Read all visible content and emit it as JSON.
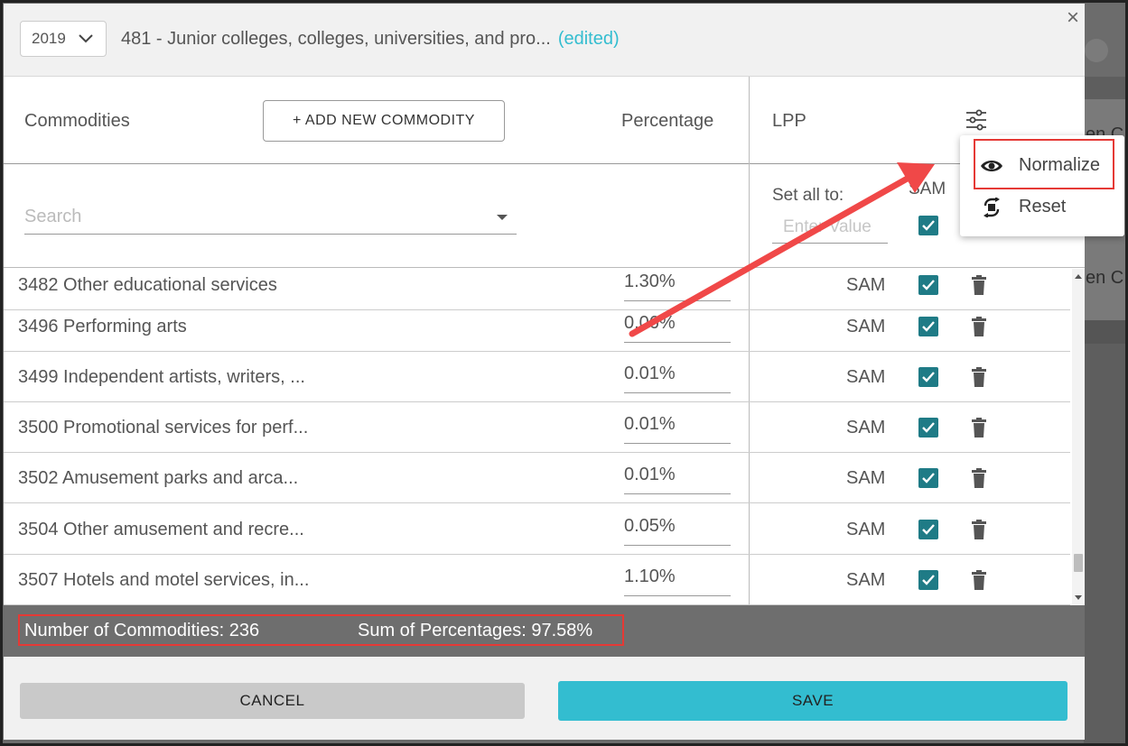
{
  "header": {
    "year": "2019",
    "sector_title": "481 - Junior colleges, colleges, universities, and pro...",
    "edited_label": "(edited)",
    "close_label": "×"
  },
  "columns": {
    "commodities": "Commodities",
    "add_button": "+ ADD NEW COMMODITY",
    "percentage": "Percentage",
    "lpp": "LPP"
  },
  "filters": {
    "search_placeholder": "Search",
    "set_all_label": "Set all to:",
    "set_all_placeholder": "Enter Value",
    "sam_label": "SAM"
  },
  "rows": [
    {
      "name": "3482 Other educational services",
      "percentage": "1.30%",
      "lpp": "SAM",
      "checked": true
    },
    {
      "name": "3496 Performing arts",
      "percentage": "0.06%",
      "lpp": "SAM",
      "checked": true
    },
    {
      "name": "3499 Independent artists, writers, ...",
      "percentage": "0.01%",
      "lpp": "SAM",
      "checked": true
    },
    {
      "name": "3500 Promotional services for perf...",
      "percentage": "0.01%",
      "lpp": "SAM",
      "checked": true
    },
    {
      "name": "3502 Amusement parks and arca...",
      "percentage": "0.01%",
      "lpp": "SAM",
      "checked": true
    },
    {
      "name": "3504 Other amusement and recre...",
      "percentage": "0.05%",
      "lpp": "SAM",
      "checked": true
    },
    {
      "name": "3507 Hotels and motel services, in...",
      "percentage": "1.10%",
      "lpp": "SAM",
      "checked": true
    }
  ],
  "summary": {
    "count": "Number of Commodities: 236",
    "sum": "Sum of Percentages: 97.58%"
  },
  "footer": {
    "cancel": "CANCEL",
    "save": "SAVE"
  },
  "menu": {
    "items": [
      {
        "label": "Normalize",
        "icon": "eye-icon"
      },
      {
        "label": "Reset",
        "icon": "reset-icon"
      }
    ]
  },
  "background_page": {
    "text_a": "en C",
    "text_b": "en C"
  },
  "colors": {
    "accent": "#33bdd0",
    "checkbox": "#1f7b86",
    "highlight": "#e53935",
    "summary_bar": "#6e6e6e"
  }
}
